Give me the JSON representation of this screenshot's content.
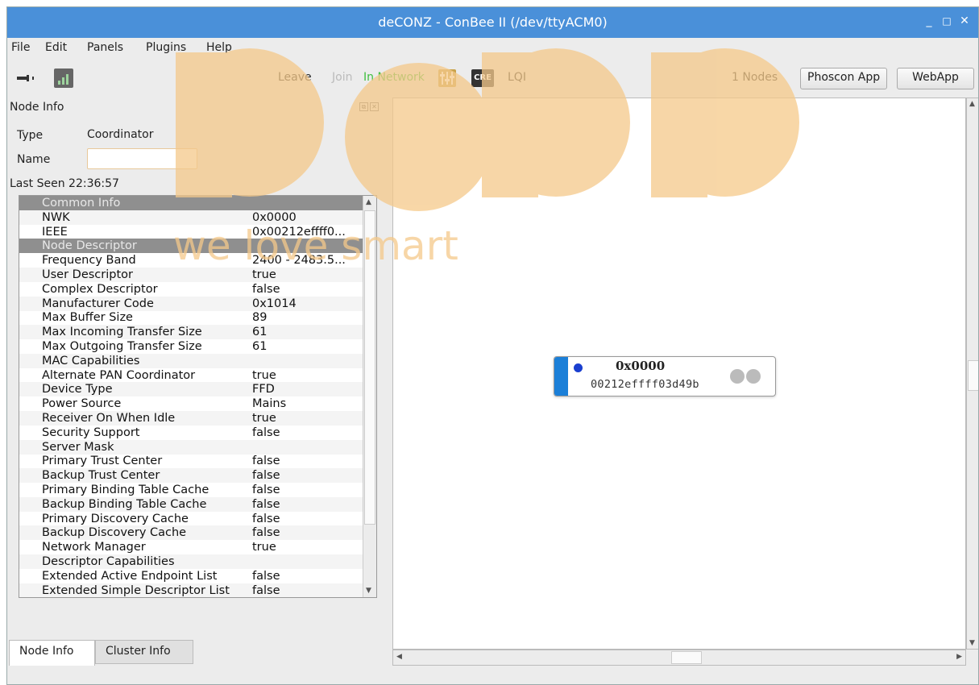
{
  "window": {
    "title": "deCONZ - ConBee II (/dev/ttyACM0)",
    "controls": {
      "minimize": "_",
      "maximize": "□",
      "close": "✕"
    }
  },
  "menu": [
    "File",
    "Edit",
    "Panels",
    "Plugins",
    "Help"
  ],
  "toolbar": {
    "leave": "Leave",
    "join": "Join",
    "status": "In Network",
    "cre_label": "CRE",
    "lqi": "LQI",
    "node_count": "1 Nodes",
    "phoscon": "Phoscon App",
    "webapp": "WebApp",
    "colors": {
      "status": "#3fbf3f",
      "join_disabled": "#bbbbbb"
    }
  },
  "node_info": {
    "title": "Node Info",
    "type_label": "Type",
    "type_value": "Coordinator",
    "name_label": "Name",
    "name_value": "",
    "last_seen": "Last Seen 22:36:57",
    "rows": [
      {
        "k": "Common Info",
        "v": "",
        "section": true
      },
      {
        "k": "NWK",
        "v": "0x0000"
      },
      {
        "k": "IEEE",
        "v": "0x00212effff0..."
      },
      {
        "k": "Node Descriptor",
        "v": "",
        "section": true
      },
      {
        "k": "Frequency Band",
        "v": "2400 - 2483.5..."
      },
      {
        "k": "User Descriptor",
        "v": "true"
      },
      {
        "k": "Complex Descriptor",
        "v": "false"
      },
      {
        "k": "Manufacturer Code",
        "v": "0x1014"
      },
      {
        "k": "Max Buffer Size",
        "v": "89"
      },
      {
        "k": "Max Incoming Transfer Size",
        "v": "61"
      },
      {
        "k": "Max Outgoing Transfer Size",
        "v": "61"
      },
      {
        "k": "MAC Capabilities",
        "v": ""
      },
      {
        "k": "Alternate PAN Coordinator",
        "v": "true"
      },
      {
        "k": "Device Type",
        "v": "FFD"
      },
      {
        "k": "Power Source",
        "v": "Mains"
      },
      {
        "k": "Receiver On When Idle",
        "v": "true"
      },
      {
        "k": "Security Support",
        "v": "false"
      },
      {
        "k": "Server Mask",
        "v": ""
      },
      {
        "k": "Primary Trust Center",
        "v": "false"
      },
      {
        "k": "Backup Trust Center",
        "v": "false"
      },
      {
        "k": "Primary Binding Table Cache",
        "v": "false"
      },
      {
        "k": "Backup Binding Table Cache",
        "v": "false"
      },
      {
        "k": "Primary Discovery Cache",
        "v": "false"
      },
      {
        "k": "Backup Discovery Cache",
        "v": "false"
      },
      {
        "k": "Network Manager",
        "v": "true"
      },
      {
        "k": "Descriptor Capabilities",
        "v": ""
      },
      {
        "k": "Extended Active Endpoint List",
        "v": "false"
      },
      {
        "k": "Extended Simple Descriptor List",
        "v": "false"
      }
    ]
  },
  "tabs": [
    "Node Info",
    "Cluster Info"
  ],
  "node": {
    "nwk": "0x0000",
    "ieee": "00212effff03d49b",
    "colors": {
      "stripe": "#1b7fd8",
      "dot": "#1a3fcf"
    }
  },
  "watermark": {
    "brand": "BOBB",
    "tagline": "we love smart",
    "color": "#f5c98a"
  }
}
